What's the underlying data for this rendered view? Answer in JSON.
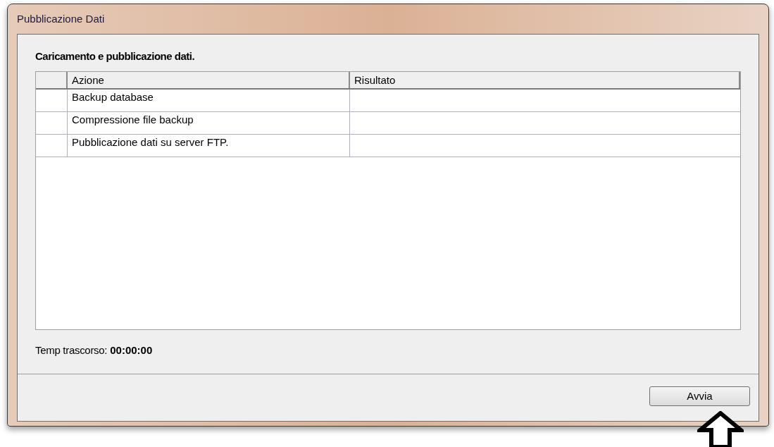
{
  "window": {
    "title": "Pubblicazione Dati"
  },
  "heading": "Caricamento e pubblicazione dati.",
  "table": {
    "columns": [
      "Azione",
      "Risultato"
    ],
    "rows": [
      {
        "azione": "Backup database",
        "risultato": ""
      },
      {
        "azione": "Compressione file backup",
        "risultato": ""
      },
      {
        "azione": "Pubblicazione dati su server FTP.",
        "risultato": ""
      }
    ]
  },
  "elapsed": {
    "label": "Temp trascorso:",
    "value": "00:00:00"
  },
  "buttons": [
    "Avvia"
  ]
}
